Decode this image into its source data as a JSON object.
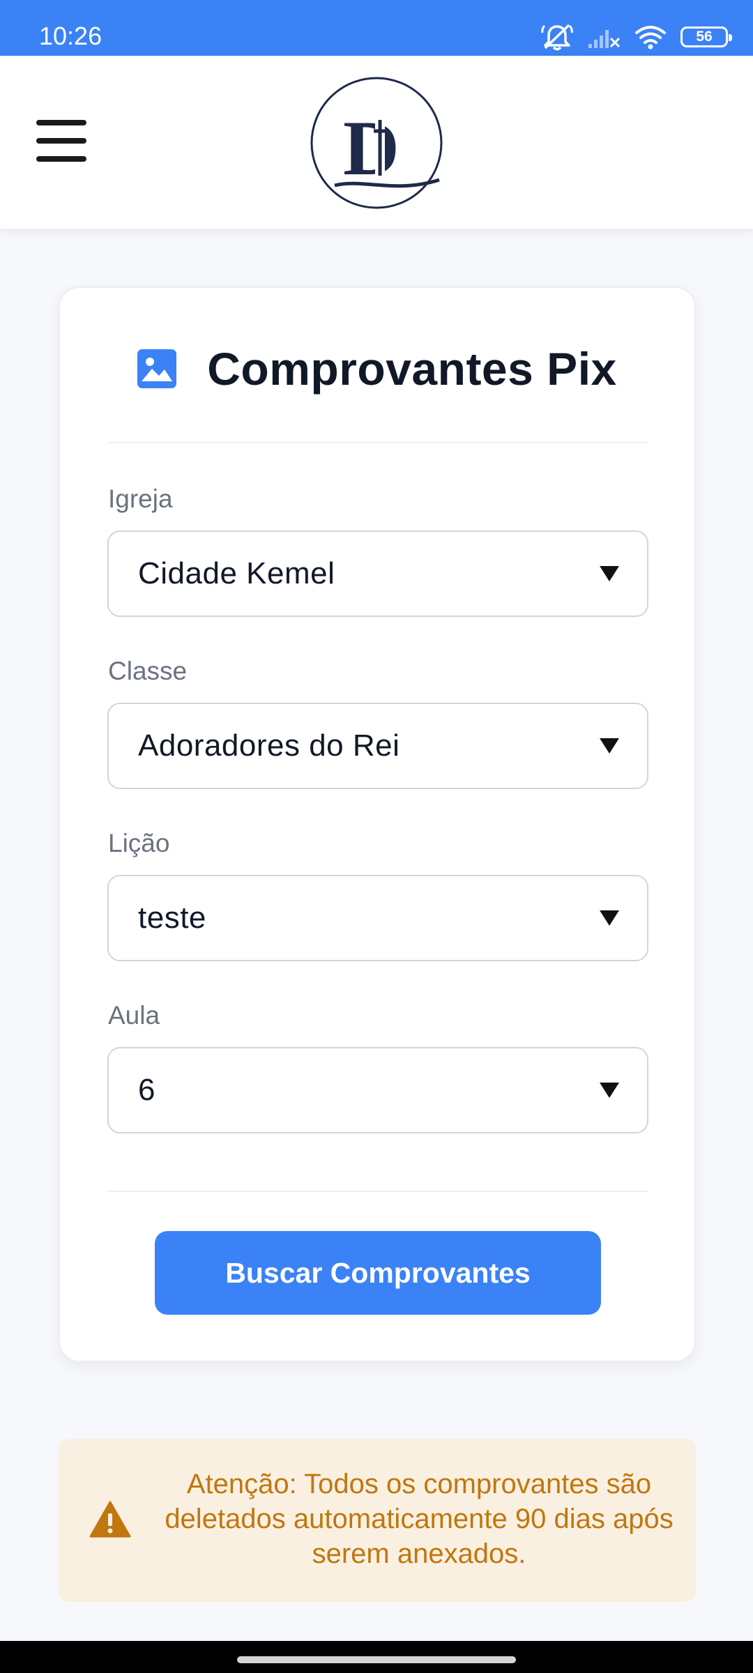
{
  "status_bar": {
    "time": "10:26",
    "battery": "56",
    "icons": [
      "bell-muted-icon",
      "cellular-signal-icon",
      "wifi-icon",
      "battery-icon"
    ]
  },
  "header": {
    "menu_icon": "hamburger-menu-icon",
    "logo_letter": "D"
  },
  "card": {
    "title": "Comprovantes Pix",
    "title_icon": "image-icon",
    "fields": [
      {
        "label": "Igreja",
        "value": "Cidade Kemel"
      },
      {
        "label": "Classe",
        "value": "Adoradores do Rei"
      },
      {
        "label": "Lição",
        "value": "teste"
      },
      {
        "label": "Aula",
        "value": "6"
      }
    ],
    "button_label": "Buscar Comprovantes"
  },
  "alert": {
    "icon": "warning-icon",
    "text": "Atenção: Todos os comprovantes são deletados automaticamente 90 dias após serem anexados."
  },
  "colors": {
    "accent": "#3b82f6",
    "alert_bg": "#f9f0e1",
    "alert_text": "#c2760e",
    "logo_navy": "#1e2a4a"
  }
}
